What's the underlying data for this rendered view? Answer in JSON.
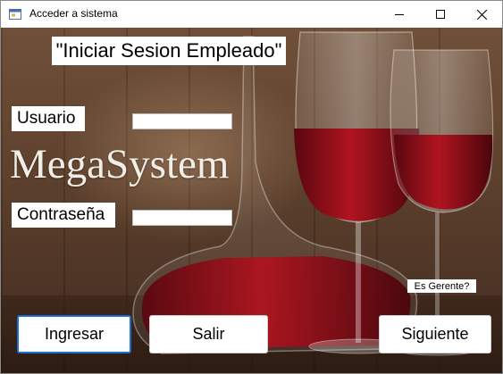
{
  "window": {
    "title": "Acceder a sistema"
  },
  "form": {
    "heading": "\"Iniciar Sesion Empleado\"",
    "username_label": "Usuario",
    "username_value": "",
    "password_label": "Contraseña",
    "password_value": "",
    "logo_text": "MegaSystem",
    "manager_checkbox_label": "Es Gerente?"
  },
  "buttons": {
    "login": "Ingresar",
    "exit": "Salir",
    "next": "Siguiente"
  },
  "icons": {
    "app": "window-app-icon",
    "minimize": "minimize-icon",
    "maximize": "maximize-icon",
    "close": "close-icon"
  },
  "colors": {
    "focus_border": "#1a6fd1",
    "wine": "#8e0f1c"
  }
}
